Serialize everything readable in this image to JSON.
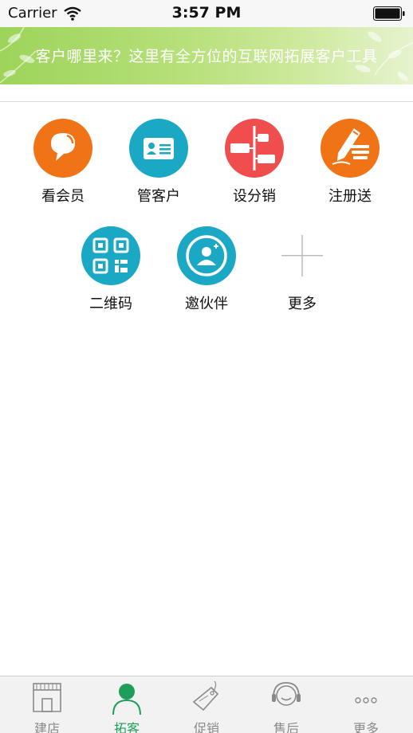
{
  "status_bar": {
    "carrier": "Carrier",
    "time": "3:57 PM"
  },
  "banner": {
    "text": "客户哪里来？这里有全方位的互联网拓展客户工具"
  },
  "grid": {
    "items": [
      {
        "label": "看会员",
        "icon": "chat-bubble-icon",
        "color": "#f07316"
      },
      {
        "label": "管客户",
        "icon": "id-card-icon",
        "color": "#1aa8c4"
      },
      {
        "label": "设分销",
        "icon": "distribution-tree-icon",
        "color": "#f04e4e"
      },
      {
        "label": "注册送",
        "icon": "register-pencil-icon",
        "color": "#f07316"
      },
      {
        "label": "二维码",
        "icon": "qr-code-icon",
        "color": "#1aa8c4"
      },
      {
        "label": "邀伙伴",
        "icon": "invite-partner-icon",
        "color": "#1aa8c4"
      },
      {
        "label": "更多",
        "icon": "plus-icon",
        "color": "#bbbbbb"
      }
    ]
  },
  "tab_bar": {
    "items": [
      {
        "label": "建店",
        "icon": "storefront-icon"
      },
      {
        "label": "拓客",
        "icon": "person-icon",
        "active": true
      },
      {
        "label": "促销",
        "icon": "sale-tag-icon"
      },
      {
        "label": "售后",
        "icon": "headset-icon"
      },
      {
        "label": "更多",
        "icon": "more-dots-icon"
      }
    ],
    "active_color": "#1f9e5a",
    "inactive_color": "#8a8a8a"
  }
}
